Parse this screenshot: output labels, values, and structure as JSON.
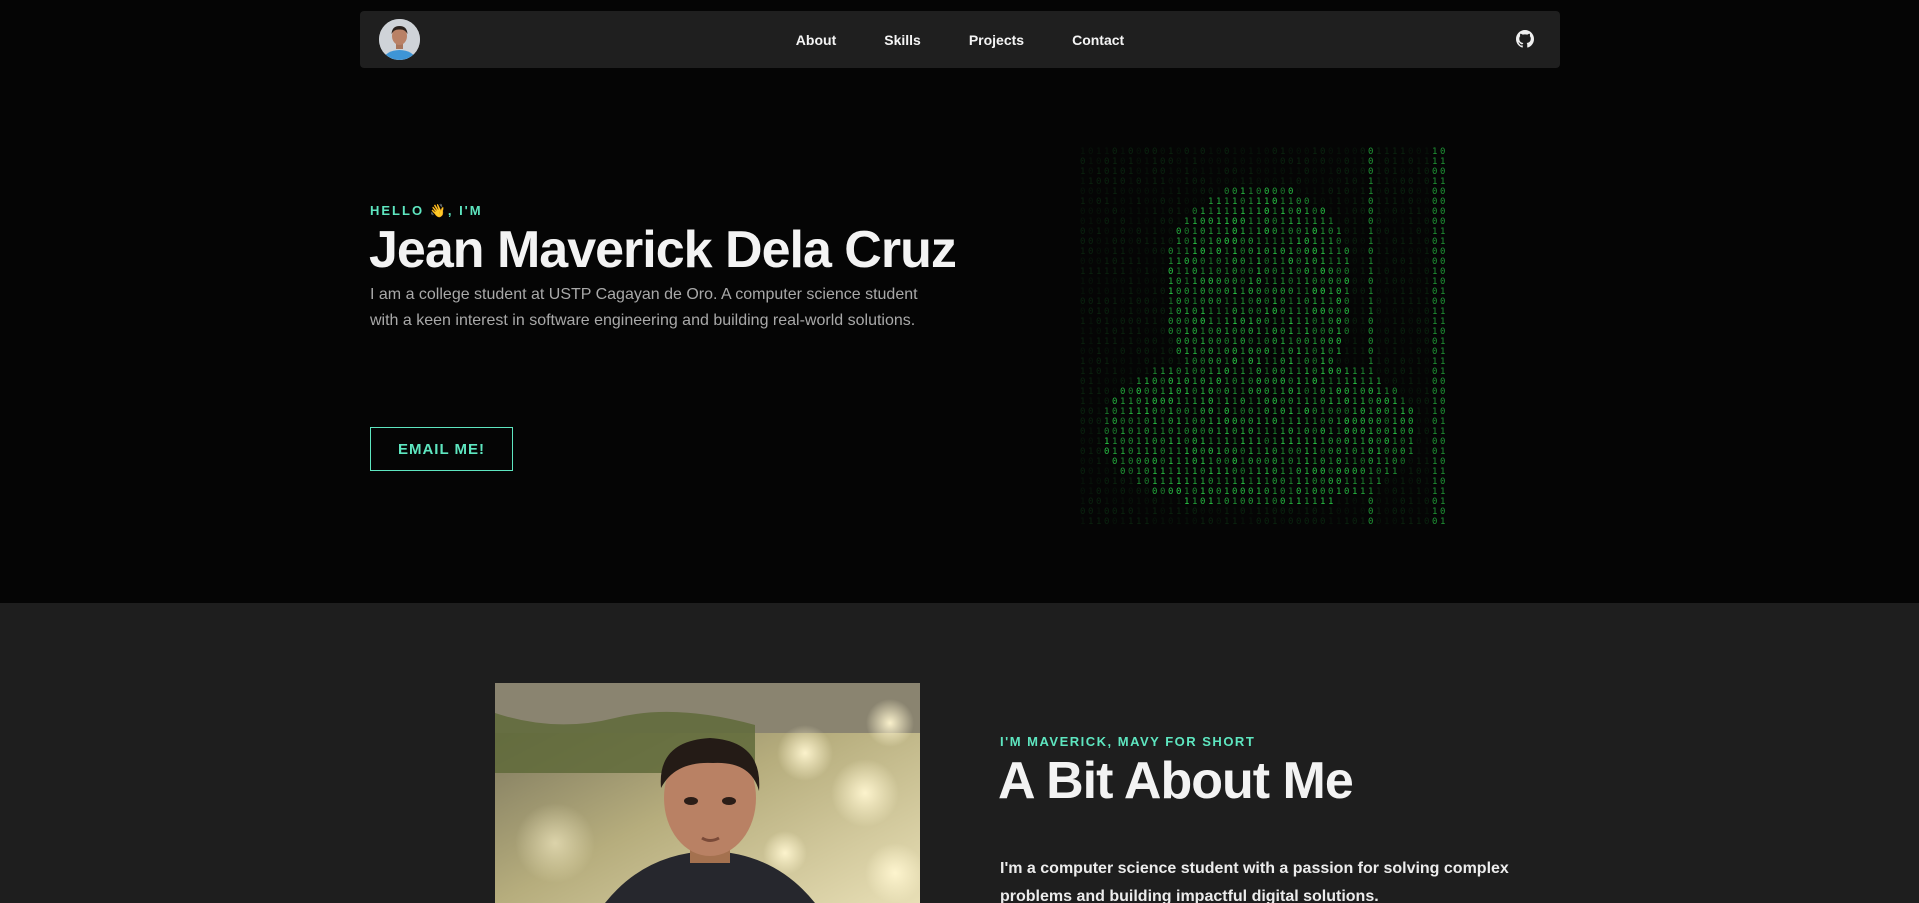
{
  "nav": {
    "links": [
      "About",
      "Skills",
      "Projects",
      "Contact"
    ]
  },
  "hero": {
    "greeting": "HELLO 👋, I'M",
    "name": "Jean Maverick Dela Cruz",
    "description": "I am a college student at USTP Cagayan de Oro. A computer science student with a keen interest in software engineering and building real-world solutions.",
    "email_button": "EMAIL ME!"
  },
  "about": {
    "kicker": "I'M MAVERICK, MAVY FOR SHORT",
    "title": "A Bit About Me",
    "text": "I'm a computer science student with a passion for solving complex problems and building impactful digital solutions."
  },
  "colors": {
    "accent": "#5ee6c0",
    "matrix_green": "#2bd24a",
    "nav_bg": "#1f1f1f",
    "hero_bg": "#050505",
    "about_bg": "#1e1e1e"
  },
  "icons": [
    "avatar",
    "github-icon",
    "matrix-portrait"
  ]
}
